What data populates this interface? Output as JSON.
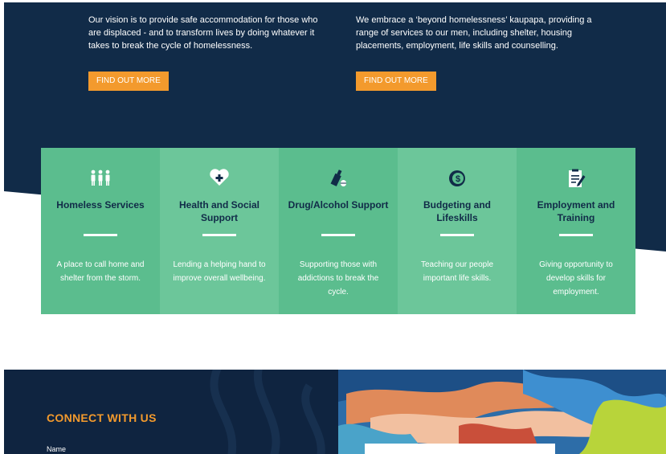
{
  "hero": {
    "left_text": "Our vision is to provide safe accommodation for those who are displaced - and to transform lives by doing whatever it takes to break the cycle of homelessness.",
    "right_text": "We embrace a ‘beyond homelessness’ kaupapa, providing a range of services to our men, including shelter, housing placements, employment, life skills and counselling.",
    "left_button": "FIND OUT MORE",
    "right_button": "FIND OUT MORE"
  },
  "services": [
    {
      "icon": "people-icon",
      "title": "Homeless Services",
      "text": "A place to call home and shelter from the storm."
    },
    {
      "icon": "heart-plus-icon",
      "title": "Health and Social Support",
      "text": "Lending a helping hand to improve overall wellbeing."
    },
    {
      "icon": "bottle-pill-icon",
      "title": "Drug/Alcohol Support",
      "text": "Supporting those with addictions to break the cycle."
    },
    {
      "icon": "dollar-coin-icon",
      "title": "Budgeting and Lifeskills",
      "text": "Teaching our people important life skills."
    },
    {
      "icon": "document-pen-icon",
      "title": "Employment and Training",
      "text": "Giving opportunity to develop skills for employment."
    }
  ],
  "connect": {
    "title": "CONNECT WITH US",
    "name_label": "Name"
  },
  "colors": {
    "navy": "#112b48",
    "orange": "#f39a2d",
    "green": "#5bbd8e",
    "green_light": "#6cc69a"
  }
}
